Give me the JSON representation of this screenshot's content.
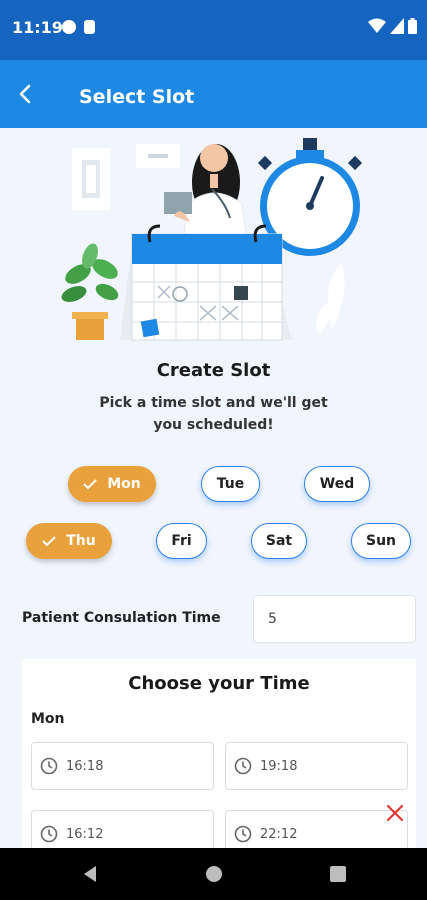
{
  "status_bar": {
    "time": "11:19"
  },
  "app_bar": {
    "title": "Select Slot"
  },
  "create": {
    "title": "Create Slot",
    "subtitle": "Pick a time slot and we'll get you scheduled!"
  },
  "days": [
    {
      "label": "Mon",
      "selected": true
    },
    {
      "label": "Tue",
      "selected": false
    },
    {
      "label": "Wed",
      "selected": false
    },
    {
      "label": "Thu",
      "selected": true
    },
    {
      "label": "Fri",
      "selected": false
    },
    {
      "label": "Sat",
      "selected": false
    },
    {
      "label": "Sun",
      "selected": false
    }
  ],
  "consultation": {
    "label": "Patient Consulation Time",
    "value": "5"
  },
  "time_section": {
    "heading": "Choose your Time",
    "day": "Mon",
    "slots": [
      "16:18",
      "19:18",
      "16:12",
      "22:12"
    ]
  },
  "colors": {
    "primary": "#1e88e5",
    "status_bar": "#1565c0",
    "selected_day": "#e9a23b",
    "remove": "#e53935",
    "background": "#f1f5fd"
  }
}
